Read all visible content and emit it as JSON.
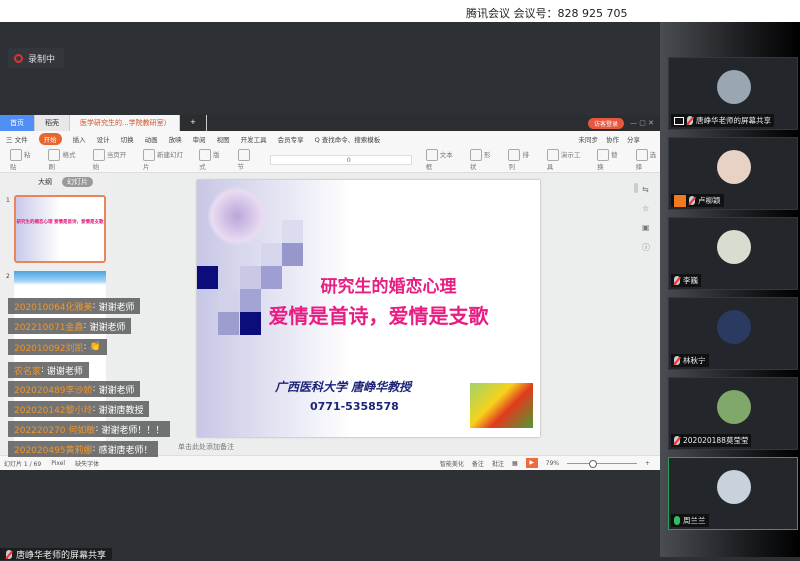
{
  "meeting": {
    "title": "腾讯会议 会议号：828 925 705",
    "recording": "录制中"
  },
  "participants": [
    {
      "name": "唐峥华老师的屏幕共享",
      "mic": "muted",
      "badge": "screen-share",
      "avatar_color": "#9aa7b3"
    },
    {
      "name": "卢柳颖",
      "mic": "muted",
      "badge": "host",
      "avatar_color": "#e8d2c6"
    },
    {
      "name": "李巍",
      "mic": "muted",
      "avatar_color": "#d9ddd0"
    },
    {
      "name": "林秋宁",
      "mic": "muted",
      "avatar_color": "#2b3a60"
    },
    {
      "name": "202020188莫莹莹",
      "mic": "muted",
      "avatar_color": "#7fa86a"
    },
    {
      "name": "周兰兰",
      "mic": "on",
      "active": true,
      "avatar_color": "#c8d2dc"
    }
  ],
  "wps": {
    "tabs": [
      "首页",
      "稻壳",
      "医学研究生的...学院教研室）"
    ],
    "login": "访客登录",
    "menu": [
      "三 文件",
      "开始",
      "插入",
      "设计",
      "切换",
      "动画",
      "放映",
      "审阅",
      "视图",
      "开发工具",
      "会员专享",
      "Q 查找命令、搜索模板"
    ],
    "menu_right": [
      "未同步",
      "协作",
      "分享"
    ],
    "ribbon": [
      "粘贴",
      "格式刷",
      "当页开始",
      "新建幻灯片",
      "版式",
      "节",
      "0",
      "文本框",
      "形状",
      "排列",
      "演示工具",
      "替换",
      "选择"
    ],
    "panel_tabs": [
      "大纲",
      "幻灯片"
    ],
    "thumb_title": "研究生的婚恋心理 爱情是首诗，爱情是支歌",
    "notes_placeholder": "单击此处添加备注",
    "status": {
      "slide": "幻灯片 1 / 69",
      "theme": "Pixel",
      "font": "缺失字体",
      "beautify": "智能美化",
      "notes": "备注",
      "comment": "批注",
      "zoom": "79%"
    }
  },
  "slide": {
    "title_line1": "研究生的婚恋心理",
    "title_line2": "爱情是首诗，爱情是支歌",
    "author": "广西医科大学 唐峥华教授",
    "phone": "0771-5358578"
  },
  "chat": [
    {
      "user": "202010064化雅美",
      "text": "谢谢老师"
    },
    {
      "user": "202210071金鑫",
      "text": "谢谢老师"
    },
    {
      "user": "202010092刘凯",
      "text": "👏"
    },
    {
      "user": "农名家",
      "text": "谢谢老师"
    },
    {
      "user": "202020489李沙娇",
      "text": "谢谢老师"
    },
    {
      "user": "202020142黎小玲",
      "text": "谢谢唐教授"
    },
    {
      "user": "202220270 何如敏",
      "text": "谢谢老师！！！"
    },
    {
      "user": "202020495黄莉娜",
      "text": "感谢唐老师！"
    }
  ],
  "bottom_share": "唐峥华老师的屏幕共享"
}
